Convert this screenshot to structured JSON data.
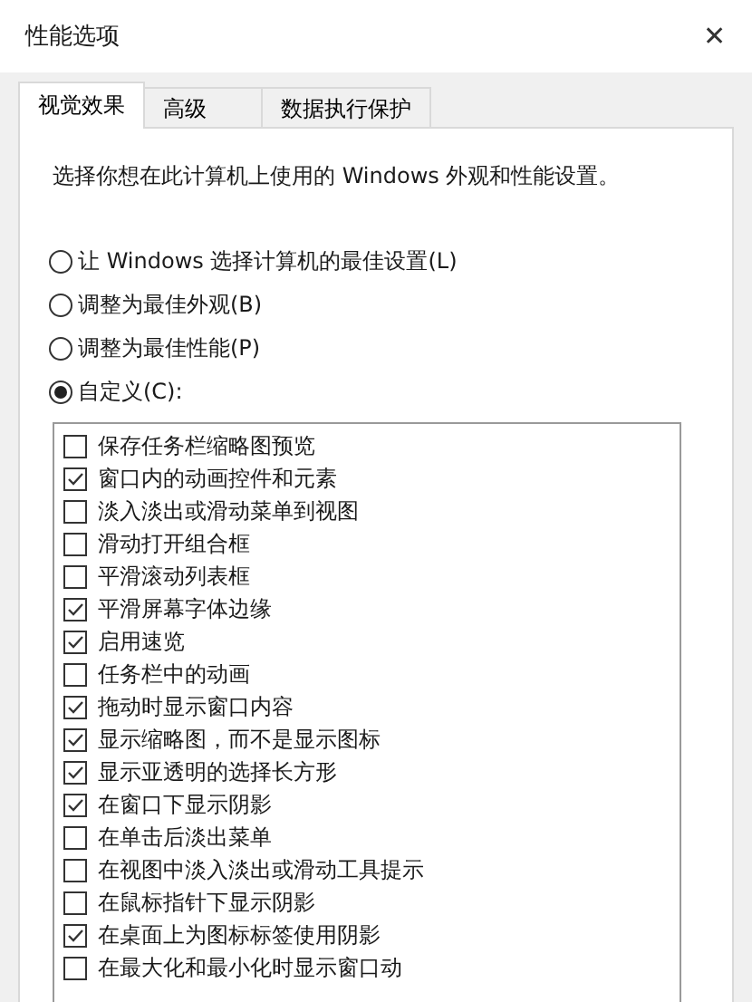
{
  "window": {
    "title": "性能选项",
    "close": "✕"
  },
  "tabs": [
    {
      "label": "视觉效果",
      "selected": true
    },
    {
      "label": "高级",
      "selected": false
    },
    {
      "label": "数据执行保护",
      "selected": false
    }
  ],
  "description": "选择你想在此计算机上使用的 Windows 外观和性能设置。",
  "options": [
    {
      "label": "让 Windows 选择计算机的最佳设置(L)",
      "selected": false
    },
    {
      "label": "调整为最佳外观(B)",
      "selected": false
    },
    {
      "label": "调整为最佳性能(P)",
      "selected": false
    },
    {
      "label": "自定义(C):",
      "selected": true
    }
  ],
  "effects": [
    {
      "label": "保存任务栏缩略图预览",
      "checked": false
    },
    {
      "label": "窗口内的动画控件和元素",
      "checked": true
    },
    {
      "label": "淡入淡出或滑动菜单到视图",
      "checked": false
    },
    {
      "label": "滑动打开组合框",
      "checked": false
    },
    {
      "label": "平滑滚动列表框",
      "checked": false
    },
    {
      "label": "平滑屏幕字体边缘",
      "checked": true
    },
    {
      "label": "启用速览",
      "checked": true
    },
    {
      "label": "任务栏中的动画",
      "checked": false
    },
    {
      "label": "拖动时显示窗口内容",
      "checked": true
    },
    {
      "label": "显示缩略图，而不是显示图标",
      "checked": true
    },
    {
      "label": "显示亚透明的选择长方形",
      "checked": true
    },
    {
      "label": "在窗口下显示阴影",
      "checked": true
    },
    {
      "label": "在单击后淡出菜单",
      "checked": false
    },
    {
      "label": "在视图中淡入淡出或滑动工具提示",
      "checked": false
    },
    {
      "label": "在鼠标指针下显示阴影",
      "checked": false
    },
    {
      "label": "在桌面上为图标标签使用阴影",
      "checked": true
    },
    {
      "label": "在最大化和最小化时显示窗口动",
      "checked": false
    }
  ]
}
